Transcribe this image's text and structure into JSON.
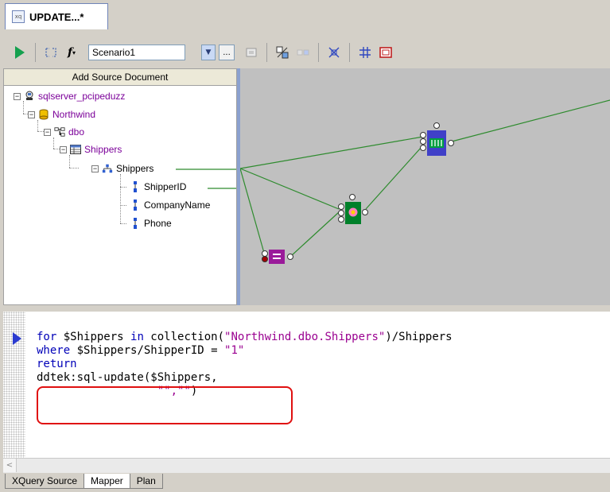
{
  "document_tab": {
    "title": "UPDATE...*",
    "icon": "xquery-file-icon"
  },
  "toolbar": {
    "scenario_value": "Scenario1",
    "scenario_button": "...",
    "icons": [
      "run-icon",
      "xquery-icon",
      "function-icon",
      "scenario-dropdown",
      "browse-icon",
      "view-icon",
      "layout-icon",
      "layout2-icon",
      "fit-icon",
      "align-icon",
      "frame-icon"
    ]
  },
  "source_pane": {
    "header": "Add Source Document",
    "tree": [
      {
        "label": "sqlserver_pcipeduzz",
        "icon": "database-server-icon"
      },
      {
        "label": "Northwind",
        "icon": "database-icon"
      },
      {
        "label": "dbo",
        "icon": "schema-icon"
      },
      {
        "label": "Shippers",
        "icon": "table-icon"
      },
      {
        "label": "Shippers",
        "icon": "row-element-icon"
      },
      {
        "label": "ShipperID",
        "icon": "column-icon"
      },
      {
        "label": "CompanyName",
        "icon": "column-icon"
      },
      {
        "label": "Phone",
        "icon": "column-icon"
      }
    ]
  },
  "editor": {
    "lines": {
      "l1_kw": "for",
      "l1_var": " $Shippers ",
      "l1_in": "in",
      "l1_fn": " collection(",
      "l1_str": "\"Northwind.dbo.Shippers\"",
      "l1_tail": ")/Shippers",
      "l2_kw": "where",
      "l2_rest": " $Shippers/ShipperID = ",
      "l2_str": "\"1\"",
      "l3_kw": "return",
      "l4": "ddtek:sql-update($Shippers,",
      "l5_pad": "                  ",
      "l5_str": "\"\",\"\"",
      "l5_tail": ")"
    }
  },
  "bottom_tabs": [
    "XQuery Source",
    "Mapper",
    "Plan"
  ],
  "active_tab": "Mapper",
  "colors": {
    "link_line": "#2e8b2e",
    "tree_purple": "#7b0099",
    "highlight": "#e01010"
  }
}
